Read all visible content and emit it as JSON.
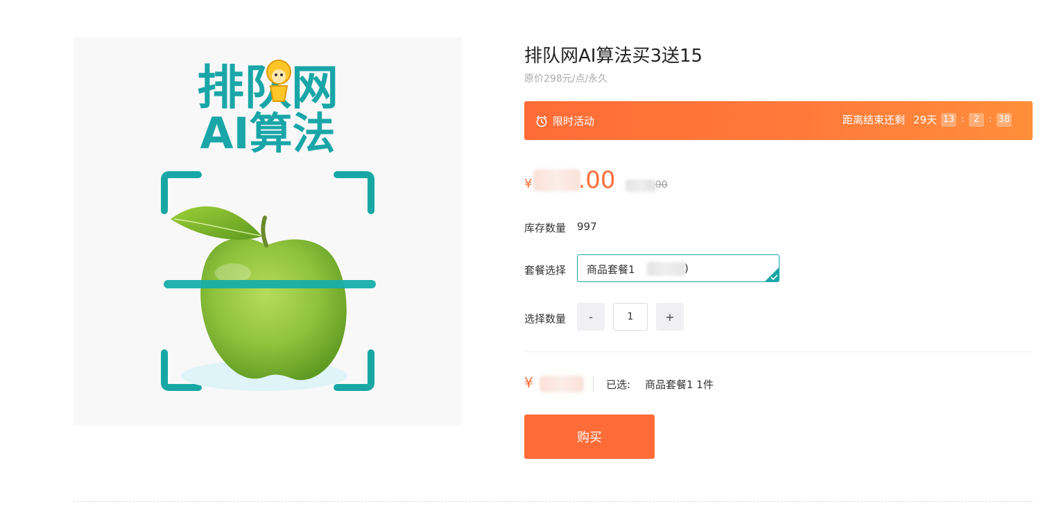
{
  "product": {
    "image_alt": "排队网AI算法",
    "image_logo_line1": "排队网",
    "image_logo_line2": "AI算法",
    "title": "排队网AI算法买3送15",
    "subtitle": "原价298元/点/永久"
  },
  "promo": {
    "label": "限时活动",
    "countdown_prefix": "距离结束还剩",
    "days": "29天",
    "hours": "13",
    "minutes": "2",
    "seconds": "38",
    "separator": ":"
  },
  "price": {
    "currency": "¥",
    "current_visible": ".00",
    "original_visible": "4.00"
  },
  "stock": {
    "label": "库存数量",
    "value": "997"
  },
  "package": {
    "label": "套餐选择",
    "option_text": "商品套餐1"
  },
  "quantity": {
    "label": "选择数量",
    "minus": "-",
    "value": "1",
    "plus": "+"
  },
  "summary": {
    "currency": "¥",
    "selected_label": "已选:",
    "selected_value": "商品套餐1 1件"
  },
  "buy_button": {
    "label": "购买"
  },
  "colors": {
    "accent": "#ff6c37",
    "teal": "#1aa6a8",
    "apple_green": "#8bc53f"
  }
}
